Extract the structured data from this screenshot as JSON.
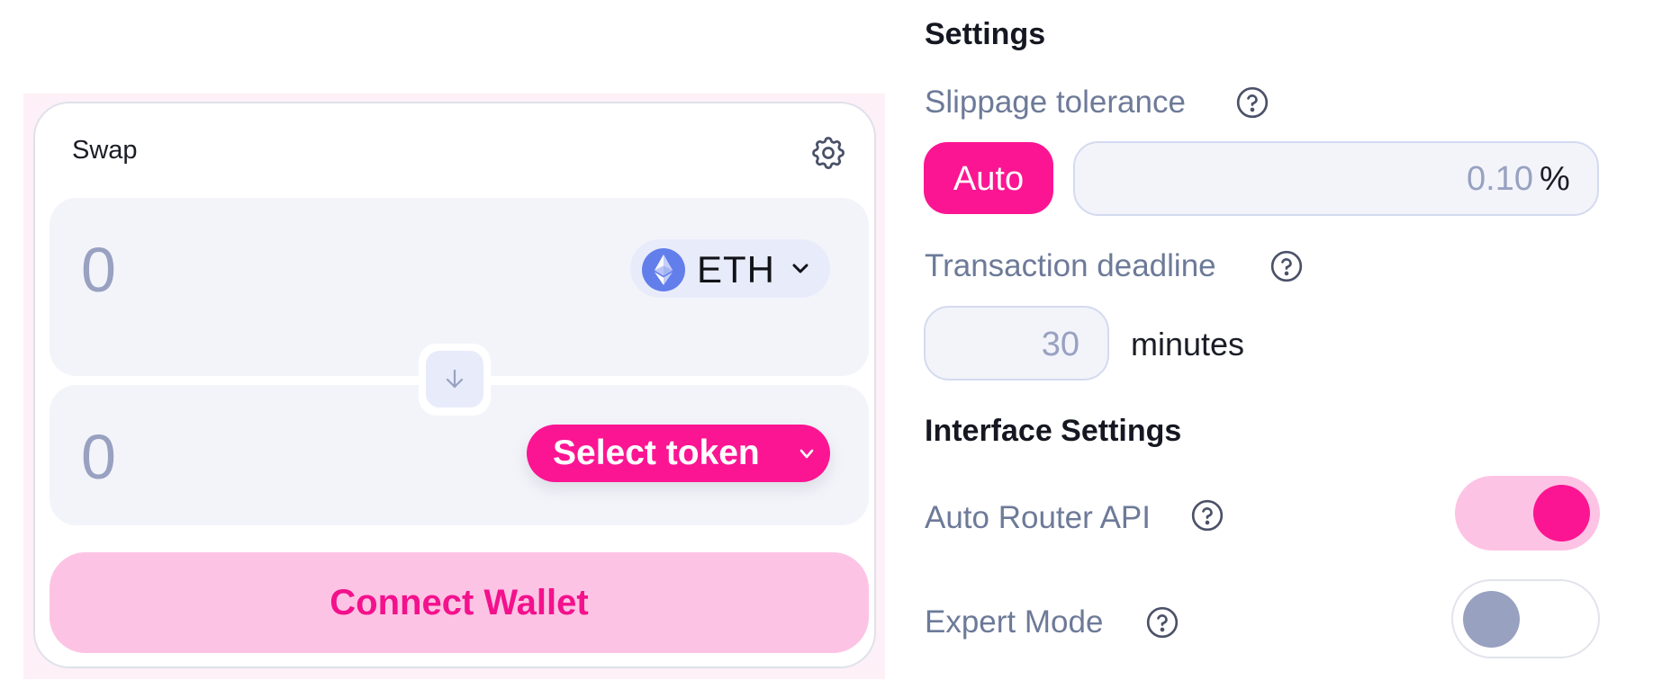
{
  "swap": {
    "title": "Swap",
    "settings_icon": "gear-icon",
    "input_token": {
      "amount_placeholder": "0",
      "token_symbol": "ETH",
      "token_icon": "ethereum-logo-icon",
      "chevron_icon": "chevron-down-icon"
    },
    "switch_icon": "arrow-down-icon",
    "output_token": {
      "amount_placeholder": "0",
      "select_label": "Select token",
      "chevron_icon": "chevron-down-icon"
    },
    "connect_wallet_label": "Connect Wallet"
  },
  "settings": {
    "title": "Settings",
    "slippage": {
      "label": "Slippage tolerance",
      "help_icon": "question-circle-icon",
      "auto_label": "Auto",
      "value_placeholder": "0.10",
      "unit": "%"
    },
    "deadline": {
      "label": "Transaction deadline",
      "help_icon": "question-circle-icon",
      "value_placeholder": "30",
      "unit": "minutes"
    },
    "interface": {
      "title": "Interface Settings",
      "auto_router": {
        "label": "Auto Router API",
        "help_icon": "question-circle-icon",
        "enabled": true
      },
      "expert_mode": {
        "label": "Expert Mode",
        "help_icon": "question-circle-icon",
        "enabled": false
      }
    }
  },
  "colors": {
    "accent": "#fc1592",
    "accent_soft": "#fdc3e4",
    "panel_bg": "#f3f4fa",
    "placeholder": "#98a1c0",
    "label": "#6d7a98",
    "eth_blue": "#627eea"
  }
}
